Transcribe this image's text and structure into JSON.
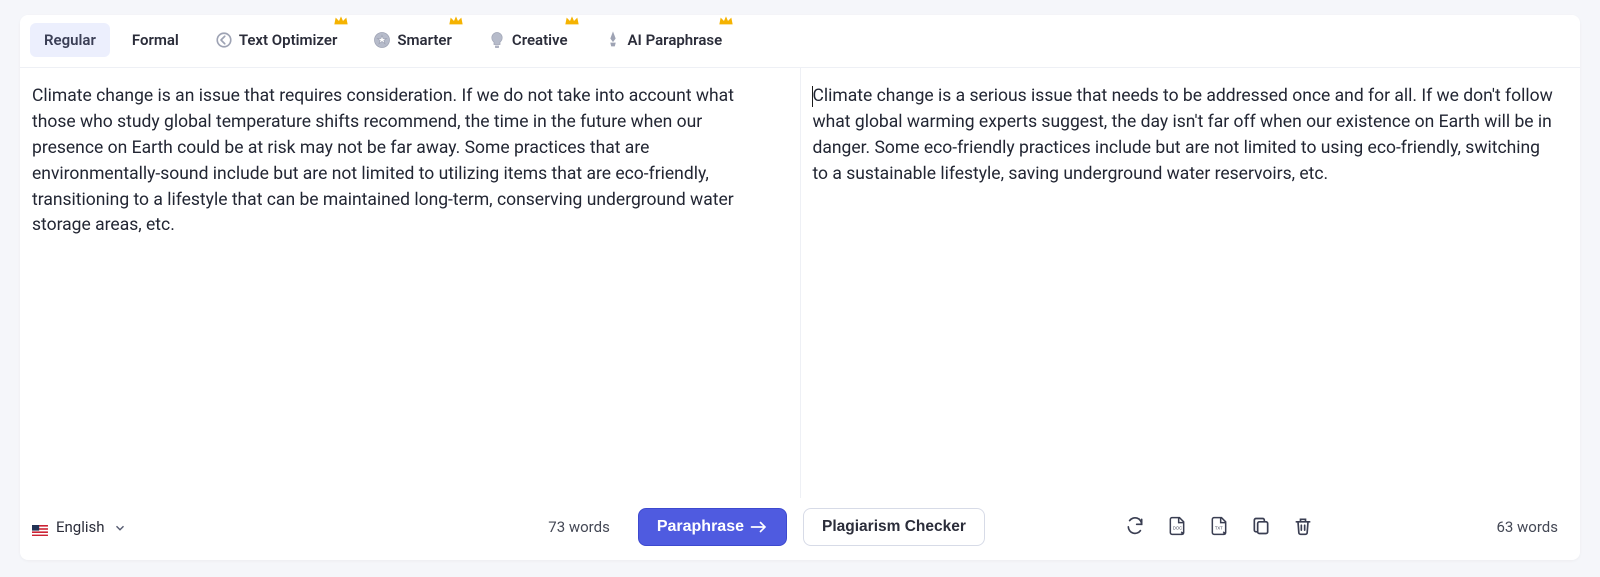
{
  "tabs": {
    "regular": "Regular",
    "formal": "Formal",
    "textOptimizer": "Text Optimizer",
    "smarter": "Smarter",
    "creative": "Creative",
    "aiParaphrase": "AI Paraphrase"
  },
  "text": {
    "input": "Climate change is an issue that requires consideration. If we do not take into account what those who study global temperature shifts recommend, the time in the future when our presence on Earth could be at risk may not be far away. Some practices that are environmentally-sound include but are not limited to utilizing items that are eco-friendly, transitioning to a lifestyle that can be maintained long-term, conserving underground water storage areas, etc.",
    "output": "Climate change is a serious issue that needs to be addressed once and for all. If we don't follow what global warming experts suggest, the day isn't far off when our existence on Earth will be in danger. Some eco-friendly practices include but are not limited to using eco-friendly, switching to a sustainable lifestyle, saving underground water reservoirs, etc."
  },
  "footer": {
    "language": "English",
    "inputWordCount": "73 words",
    "paraphraseLabel": "Paraphrase",
    "plagiarismLabel": "Plagiarism Checker",
    "outputWordCount": "63 words"
  }
}
